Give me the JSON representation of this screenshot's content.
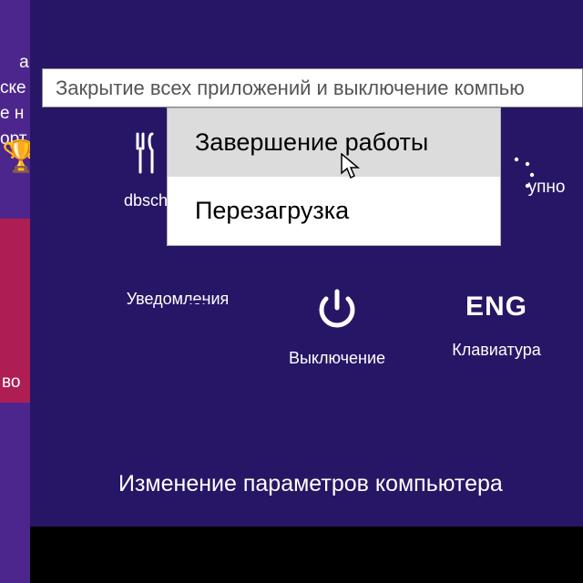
{
  "left_tiles": {
    "top_fragment": "авн\nске\nе н\nорт",
    "trophy_icon": "trophy-icon",
    "bottom_fragment": "во"
  },
  "tooltip_text": "Закрытие всех приложений и выключение компью",
  "row1": {
    "dbsch_label": "dbsch",
    "right_label_fragment": "упно"
  },
  "menu": {
    "shutdown": "Завершение работы",
    "restart": "Перезагрузка"
  },
  "row2": {
    "notifications": "Уведомления",
    "power": "Выключение",
    "keyboard_lang": "ENG",
    "keyboard": "Клавиатура"
  },
  "settings_link": "Изменение параметров компьютера"
}
